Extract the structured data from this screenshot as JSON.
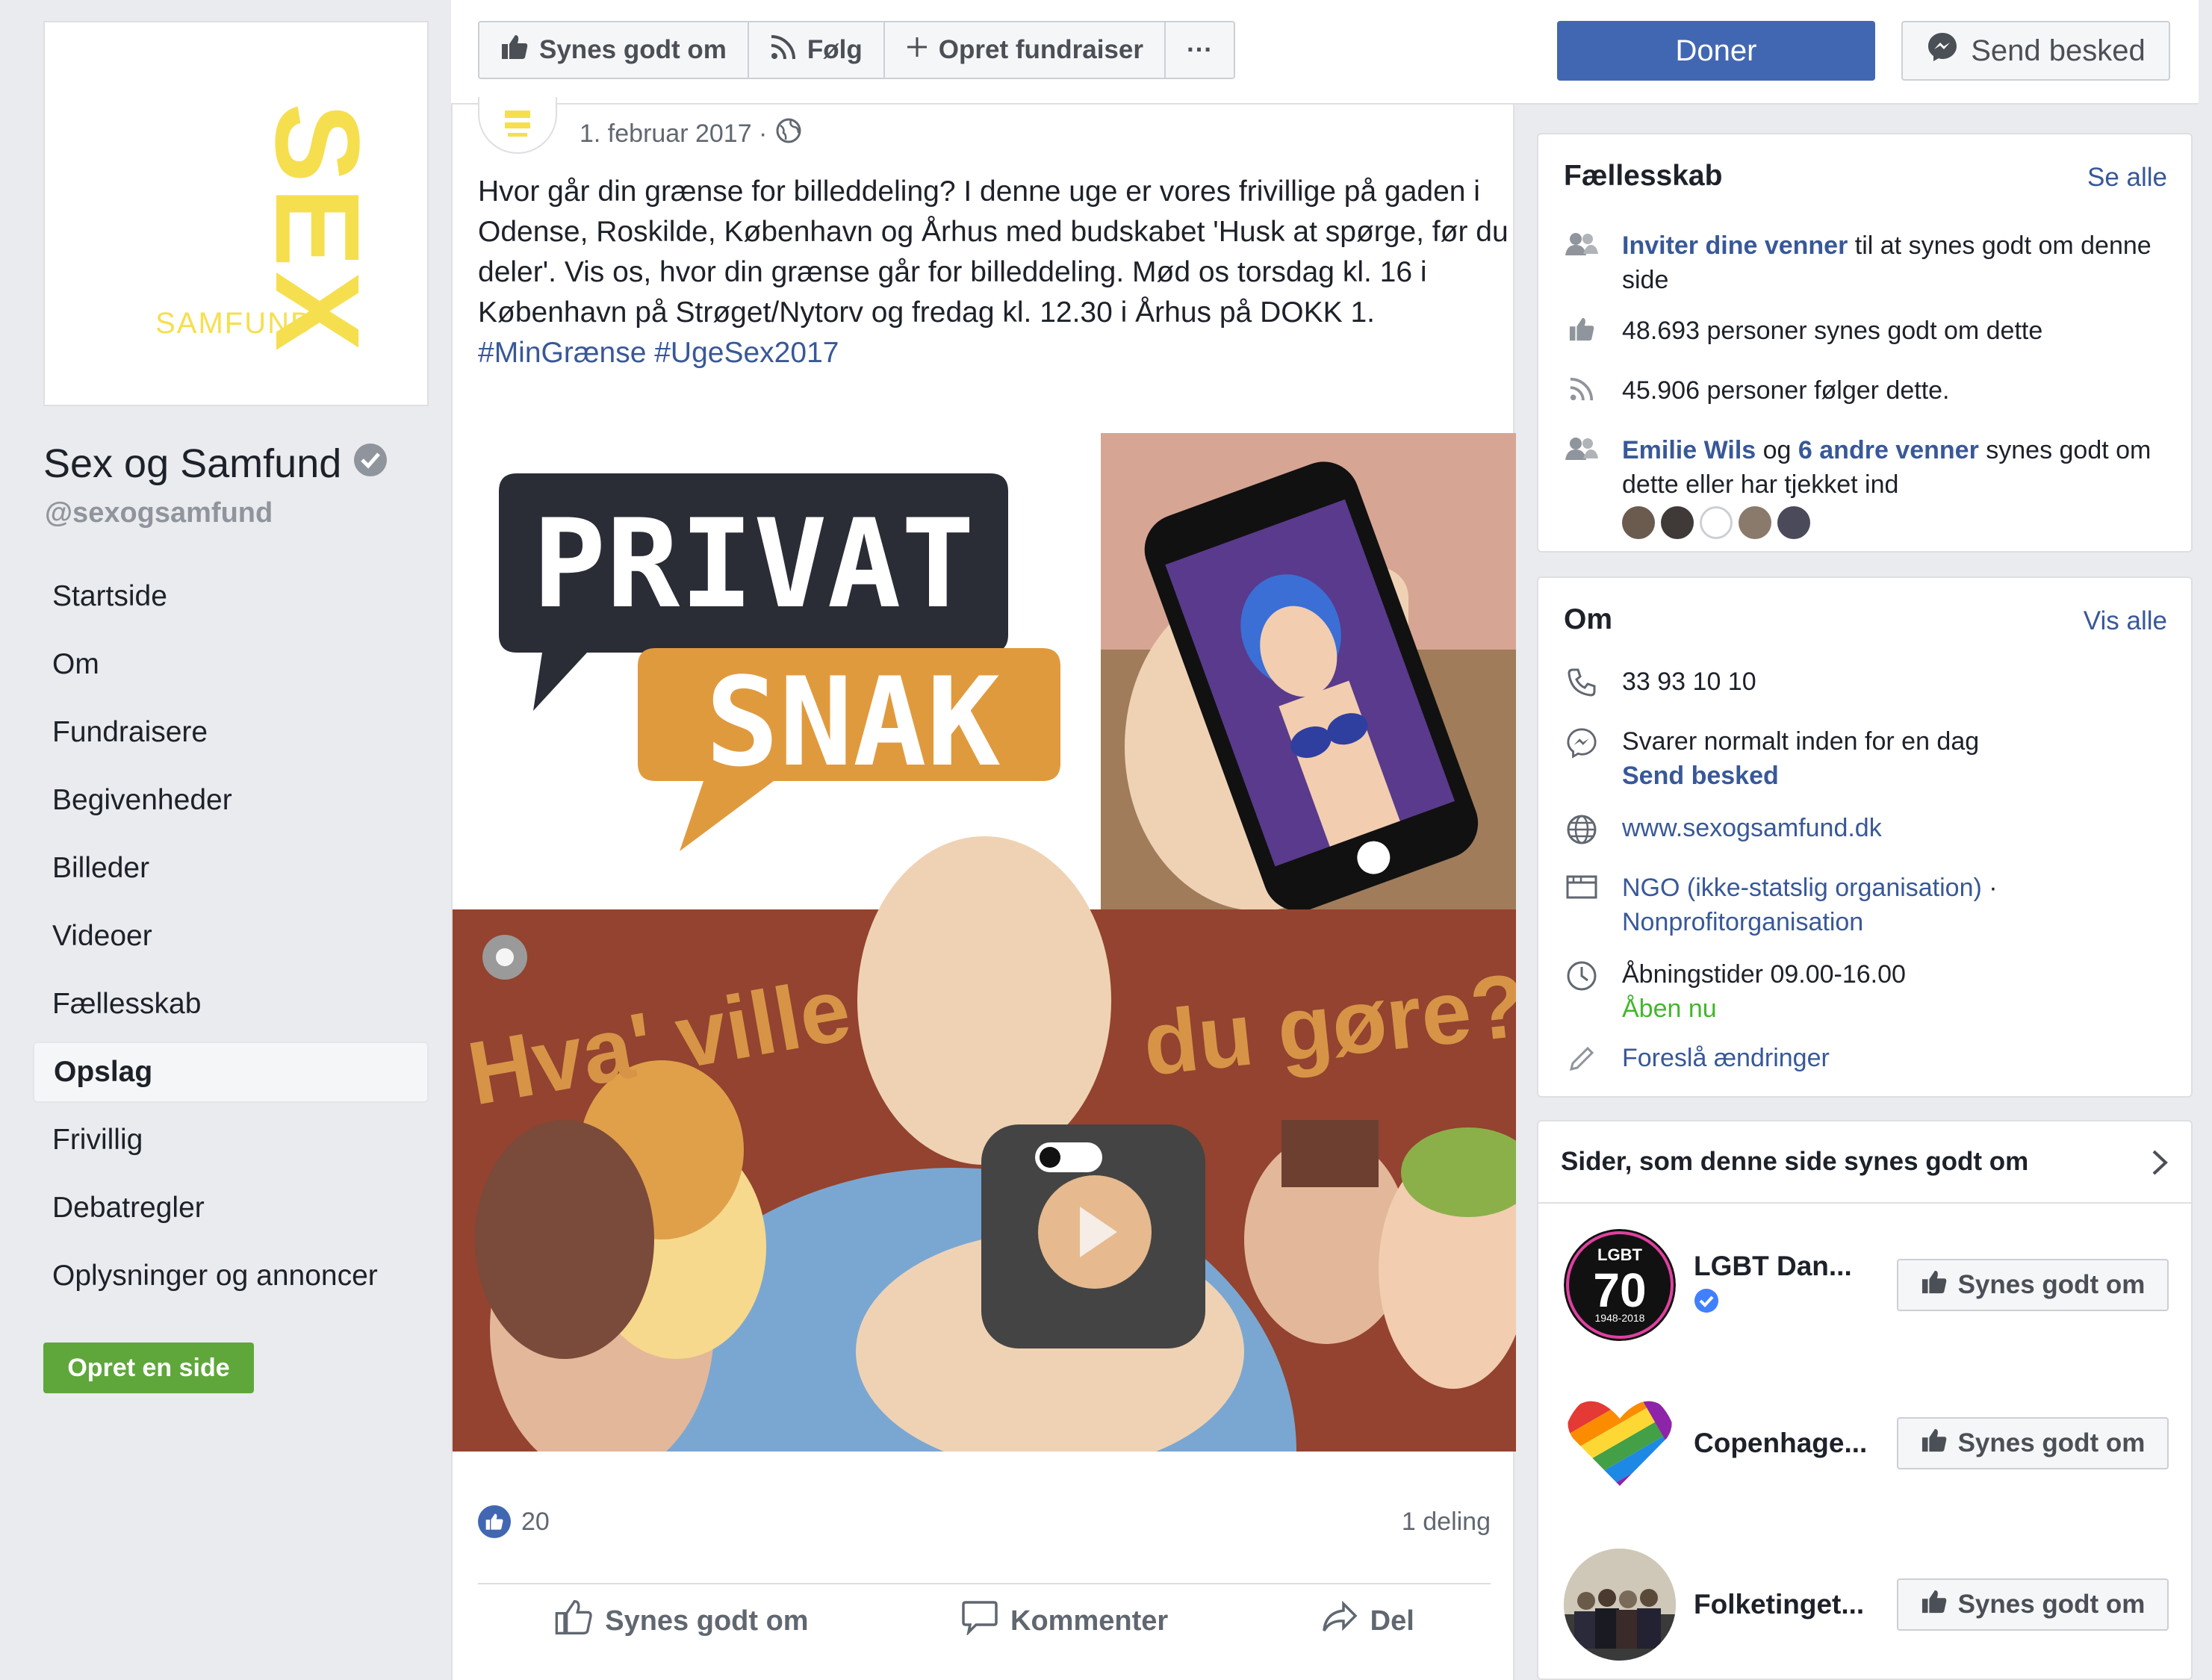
{
  "page": {
    "name": "Sex og Samfund",
    "handle": "@sexogsamfund",
    "logo_text_main": "SEX",
    "logo_text_sub": "SAMFUND"
  },
  "nav": {
    "items": [
      {
        "label": "Startside"
      },
      {
        "label": "Om"
      },
      {
        "label": "Fundraisere"
      },
      {
        "label": "Begivenheder"
      },
      {
        "label": "Billeder"
      },
      {
        "label": "Videoer"
      },
      {
        "label": "Fællesskab"
      },
      {
        "label": "Opslag",
        "active": true
      },
      {
        "label": "Frivillig"
      },
      {
        "label": "Debatregler"
      },
      {
        "label": "Oplysninger og annoncer"
      }
    ],
    "create_page": "Opret en side"
  },
  "topbar": {
    "like": "Synes godt om",
    "follow": "Følg",
    "fundraiser": "Opret fundraiser",
    "more": "···",
    "donate": "Doner",
    "send_message": "Send besked"
  },
  "post": {
    "date": "1. februar 2017 ·",
    "text": "Hvor går din grænse for billeddeling? I denne uge er vores frivillige på gaden i Odense, Roskilde, København og Århus med budskabet 'Husk at spørge, før du deler'. Vis os, hvor din grænse går for billeddeling. Mød os torsdag kl. 16 i København på Strøget/Nytorv og fredag kl. 12.30 i Århus på DOKK 1.",
    "tags": "#MinGrænse #UgeSex2017",
    "image": {
      "bubble_top": "PRIVAT",
      "bubble_bottom": "SNAK",
      "slogan_left": "Hva' ville",
      "slogan_right": "du gøre?"
    },
    "likes": "20",
    "shares": "1 deling",
    "actions": {
      "like": "Synes godt om",
      "comment": "Kommenter",
      "share": "Del"
    }
  },
  "community": {
    "title": "Fællesskab",
    "see_all": "Se alle",
    "invite_link": "Inviter dine venner",
    "invite_rest": " til at synes godt om denne side",
    "likes_text": "48.693 personer synes godt om dette",
    "follows_text": "45.906 personer følger dette.",
    "friend_name": "Emilie Wils",
    "friends_mid": " og ",
    "friends_link": "6 andre venner",
    "friends_rest": " synes godt om dette eller har tjekket ind"
  },
  "about": {
    "title": "Om",
    "see_all": "Vis alle",
    "phone": "33 93 10 10",
    "response": "Svarer normalt inden for en dag",
    "send_message": "Send besked",
    "website": "www.sexogsamfund.dk",
    "category": "NGO (ikke-statslig organisation)",
    "category_sep": " ·",
    "category2": "Nonprofitorganisation",
    "hours": "Åbningstider 09.00-16.00",
    "open_now": "Åben nu",
    "suggest": "Foreslå ændringer"
  },
  "liked_pages": {
    "title": "Sider, som denne side synes godt om",
    "items": [
      {
        "name": "LGBT Dan...",
        "verified": true,
        "button": "Synes godt om",
        "thumb_text": "LGBT",
        "thumb_number": "70",
        "thumb_years": "1948-2018"
      },
      {
        "name": "Copenhage...",
        "button": "Synes godt om"
      },
      {
        "name": "Folketinget...",
        "button": "Synes godt om"
      }
    ]
  },
  "colors": {
    "brand_blue": "#4267b2",
    "link": "#385898",
    "logo_yellow": "#f6df4f",
    "green_button": "#5fa73b",
    "open_green": "#42b72a"
  }
}
